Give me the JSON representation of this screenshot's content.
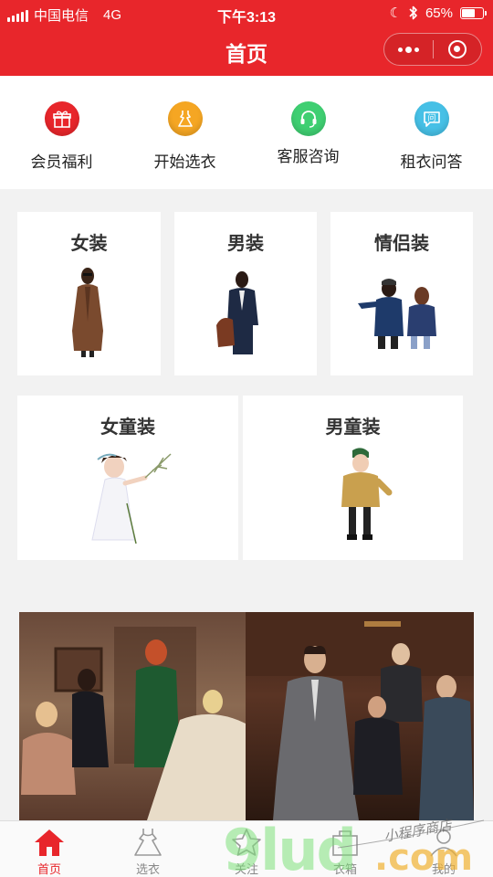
{
  "status_bar": {
    "carrier": "中国电信",
    "network": "4G",
    "time": "下午3:13",
    "battery_percent": "65%",
    "battery_level": 0.65
  },
  "nav": {
    "title": "首页"
  },
  "quick_menu": [
    {
      "label": "会员福利",
      "icon": "gift-icon",
      "color": "#e8262b"
    },
    {
      "label": "开始选衣",
      "icon": "dress-icon",
      "color": "#f5a623"
    },
    {
      "label": "客服咨询",
      "icon": "headset-icon",
      "color": "#3fcf72"
    },
    {
      "label": "租衣问答",
      "icon": "question-bubble-icon",
      "color": "#46c0e6"
    }
  ],
  "categories": [
    {
      "title": "女装"
    },
    {
      "title": "男装"
    },
    {
      "title": "情侣装"
    },
    {
      "title": "女童装"
    },
    {
      "title": "男童装"
    }
  ],
  "tabs": [
    {
      "label": "首页",
      "icon": "home-icon",
      "active": true
    },
    {
      "label": "选衣",
      "icon": "dress-outline-icon",
      "active": false
    },
    {
      "label": "关注",
      "icon": "star-icon",
      "active": false
    },
    {
      "label": "衣箱",
      "icon": "box-icon",
      "active": false
    },
    {
      "label": "我的",
      "icon": "user-icon",
      "active": false
    }
  ],
  "watermark": {
    "text": "9lud.com",
    "subtitle": "小程序商店"
  },
  "colors": {
    "brand_red": "#e8262b",
    "background": "#f2f2f2"
  }
}
